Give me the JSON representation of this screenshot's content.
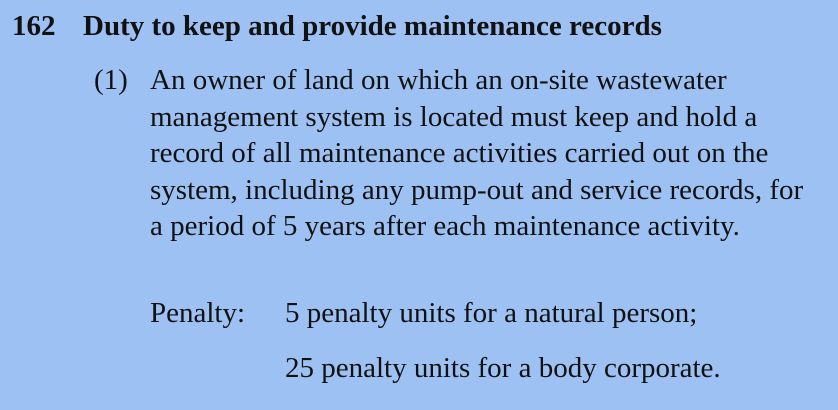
{
  "section": {
    "number": "162",
    "title": "Duty to keep and provide maintenance records"
  },
  "subsection": {
    "number": "(1)",
    "text": "An owner of land on which an on-site wastewater management system is located must keep and hold a record of all maintenance activities carried out on the system, including any pump-out and service records, for a period of 5 years after each maintenance activity."
  },
  "penalty": {
    "label": "Penalty:",
    "natural_person": "5 penalty units for a natural person;",
    "body_corporate": "25 penalty units for a body corporate."
  },
  "colors": {
    "background": "#9ec1f4",
    "text": "#111111"
  }
}
